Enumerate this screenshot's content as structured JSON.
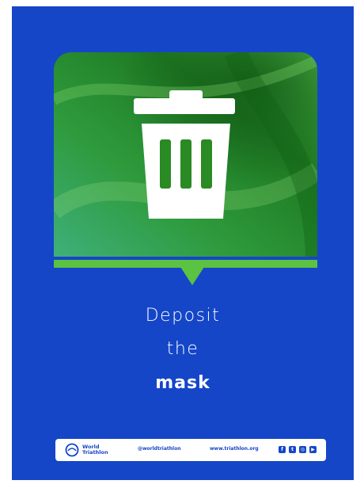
{
  "poster": {
    "headline_line1": "Deposit",
    "headline_line2": "the",
    "headline_line3": "mask",
    "icon": "trash-bin-icon",
    "colors": {
      "background": "#1546c8",
      "accent_green": "#5cc241",
      "panel_green": "#2f8f2a",
      "text": "#ffffff"
    }
  },
  "footer": {
    "brand_line1": "World",
    "brand_line2": "Triathlon",
    "handle": "@worldtriathlon",
    "website": "www.triathlon.org",
    "social_icons": [
      "facebook-icon",
      "twitter-icon",
      "instagram-icon",
      "youtube-icon"
    ]
  }
}
